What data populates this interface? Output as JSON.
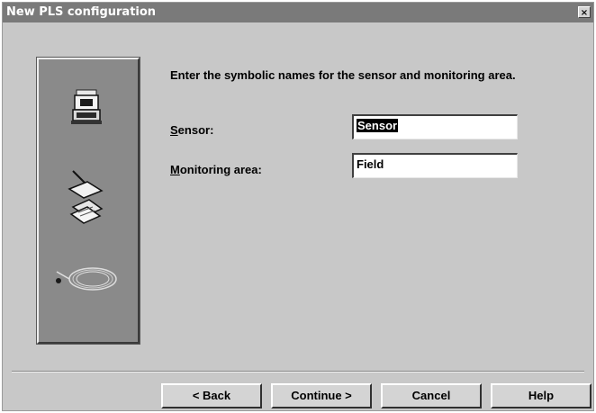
{
  "window": {
    "title": "New PLS configuration",
    "close_glyph": "×"
  },
  "panel": {
    "icons": [
      "scanner-device-icon",
      "pen-documents-icon",
      "cable-coil-icon"
    ]
  },
  "prompt": "Enter the symbolic names for the sensor and monitoring area.",
  "fields": {
    "sensor": {
      "label_mnemonic": "S",
      "label_rest": "ensor:",
      "value": "Sensor"
    },
    "monitoring": {
      "label_mnemonic": "M",
      "label_rest": "onitoring area:",
      "value": "Field"
    }
  },
  "buttons": {
    "back": "< Back",
    "continue": "Continue >",
    "cancel": "Cancel",
    "help": "Help"
  }
}
